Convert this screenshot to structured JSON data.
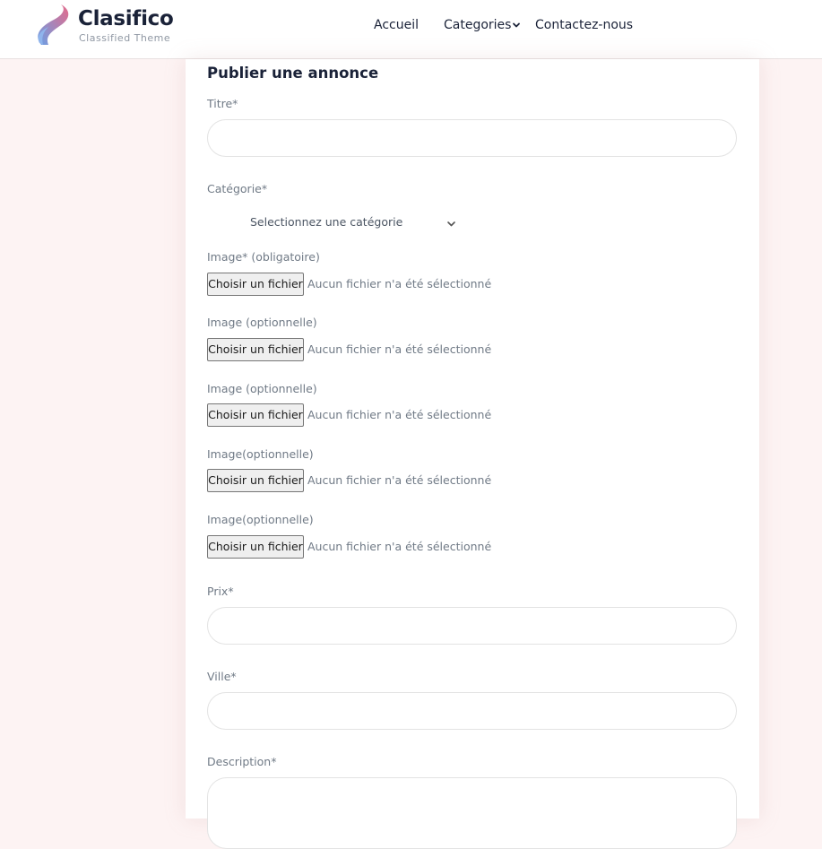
{
  "header": {
    "logo": {
      "name": "Clasifico",
      "tagline": "Classified Theme",
      "colors": [
        "#e66a8a",
        "#6aa0e6"
      ]
    },
    "nav": {
      "home": "Accueil",
      "categories": "Categories",
      "contact": "Contactez-nous"
    }
  },
  "form": {
    "title": "Publier une annonce",
    "titre_label": "Titre*",
    "titre_value": "",
    "categorie_label": "Catégorie*",
    "categorie_selected": "Selectionnez une catégorie",
    "images": [
      {
        "label": "Image* (obligatoire)",
        "button": "Choisir un fichier",
        "status": "Aucun fichier n'a été sélectionné"
      },
      {
        "label": "Image (optionnelle)",
        "button": "Choisir un fichier",
        "status": "Aucun fichier n'a été sélectionné"
      },
      {
        "label": "Image (optionnelle)",
        "button": "Choisir un fichier",
        "status": "Aucun fichier n'a été sélectionné"
      },
      {
        "label": "Image(optionnelle)",
        "button": "Choisir un fichier",
        "status": "Aucun fichier n'a été sélectionné"
      },
      {
        "label": "Image(optionnelle)",
        "button": "Choisir un fichier",
        "status": "Aucun fichier n'a été sélectionné"
      }
    ],
    "prix_label": "Prix*",
    "prix_value": "",
    "ville_label": "Ville*",
    "ville_value": "",
    "description_label": "Description*",
    "description_value": ""
  },
  "colors": {
    "page_bg": "#fdf3f3",
    "text_dark": "#1a2238",
    "label_gray": "#707a86"
  }
}
